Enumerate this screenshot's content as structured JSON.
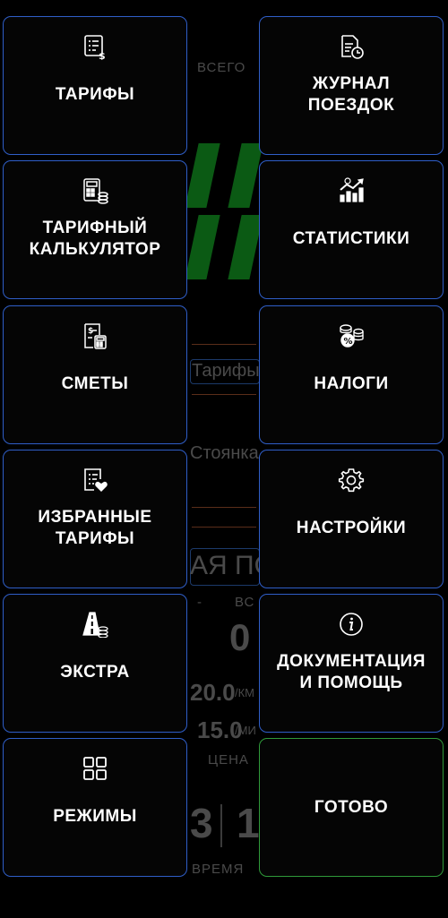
{
  "background": {
    "total_label": "ВСЕГО",
    "tariff_label": "Тарифы",
    "parking_label": "Стоянка",
    "big_text": "АЯ ПО",
    "dash": "-",
    "total_short": "ВС",
    "zero": "0",
    "rate_km": "20.0",
    "rate_km_unit": "/КМ",
    "rate_min": "15.0",
    "rate_min_unit": "/МИ",
    "price_label": "ЦЕНА",
    "digit_left": "3",
    "digit_right": "1",
    "time_label": "ВРЕМЯ",
    "segment_color": "#0b5a14"
  },
  "menu": {
    "border_color": "#2f5ec8",
    "done_border_color": "#2f9a3a",
    "items": [
      {
        "label": "ТАРИФЫ",
        "icon": "price-list-icon"
      },
      {
        "label": "ЖУРНАЛ ПОЕЗДОК",
        "icon": "trip-log-icon"
      },
      {
        "label": "ТАРИФНЫЙ\nКАЛЬКУЛЯТОР",
        "icon": "calculator-coins-icon"
      },
      {
        "label": "СТАТИСТИКИ",
        "icon": "statistics-chart-icon"
      },
      {
        "label": "СМЕТЫ",
        "icon": "estimate-calculator-icon"
      },
      {
        "label": "НАЛОГИ",
        "icon": "tax-coins-icon"
      },
      {
        "label": "ИЗБРАННЫЕ\nТАРИФЫ",
        "icon": "favorite-list-icon"
      },
      {
        "label": "НАСТРОЙКИ",
        "icon": "gear-icon"
      },
      {
        "label": "ЭКСТРА",
        "icon": "road-coins-icon"
      },
      {
        "label": "ДОКУМЕНТАЦИЯ\nИ ПОМОЩЬ",
        "icon": "info-icon"
      },
      {
        "label": "РЕЖИМЫ",
        "icon": "grid-icon"
      },
      {
        "label": "ГОТОВО",
        "icon": ""
      }
    ]
  }
}
